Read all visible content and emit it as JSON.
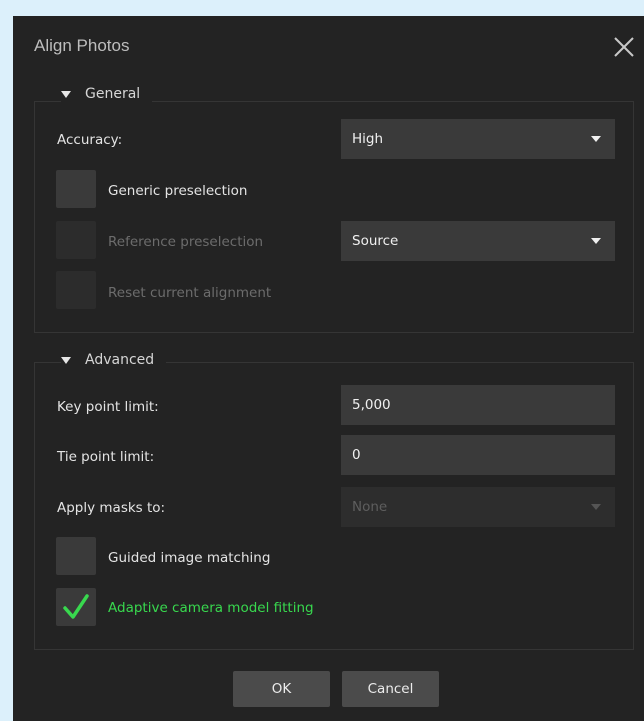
{
  "dialog": {
    "title": "Align Photos",
    "close_icon": "close-icon"
  },
  "general": {
    "header": "General",
    "accuracy": {
      "label": "Accuracy:",
      "value": "High"
    },
    "generic_preselection": {
      "label": "Generic preselection",
      "checked": false
    },
    "reference_preselection": {
      "label": "Reference preselection",
      "checked": false,
      "value": "Source"
    },
    "reset_alignment": {
      "label": "Reset current alignment",
      "checked": false
    }
  },
  "advanced": {
    "header": "Advanced",
    "key_point_limit": {
      "label": "Key point limit:",
      "value": "5,000"
    },
    "tie_point_limit": {
      "label": "Tie point limit:",
      "value": "0"
    },
    "apply_masks": {
      "label": "Apply masks to:",
      "value": "None"
    },
    "guided_matching": {
      "label": "Guided image matching",
      "checked": false
    },
    "adaptive_fitting": {
      "label": "Adaptive camera model fitting",
      "checked": true
    }
  },
  "buttons": {
    "ok": "OK",
    "cancel": "Cancel"
  },
  "colors": {
    "background": "#232323",
    "accent_green": "#38d84e",
    "page": "#dcf0fb"
  }
}
